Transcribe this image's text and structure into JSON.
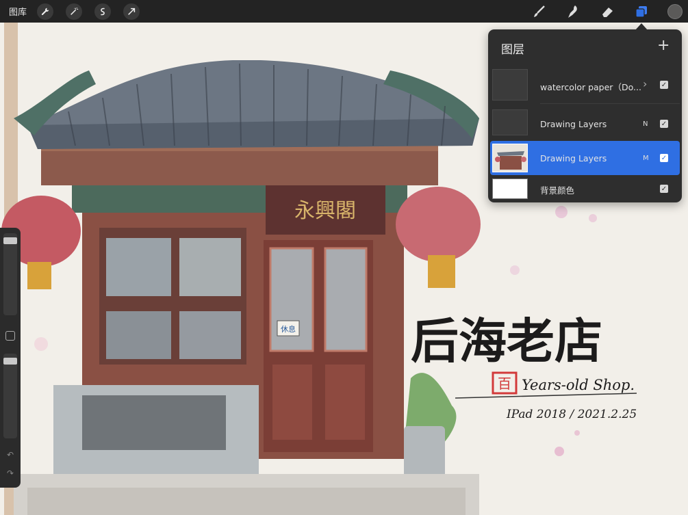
{
  "topbar": {
    "gallery_label": "图库",
    "left_tools": [
      "wrench-icon",
      "magic-wand-icon",
      "selection-icon",
      "transform-arrow-icon"
    ],
    "right_tools": [
      "brush-icon",
      "smudge-icon",
      "eraser-icon",
      "layers-icon"
    ],
    "active_color": "#5b5a59",
    "accent": "#2f6fe3"
  },
  "artwork": {
    "sign_text": "永興閣",
    "door_note": "休息",
    "title": "后海老店",
    "seal": "百",
    "subtitle": "Years-old Shop.",
    "signature": "IPad 2018 / 2021.2.25"
  },
  "layers_panel": {
    "title": "图层",
    "add_label": "+",
    "layers": [
      {
        "name": "watercolor paper（Do...",
        "blend": "",
        "visible": true,
        "selected": false,
        "has_chevron": true
      },
      {
        "name": "Drawing Layers",
        "blend": "N",
        "visible": true,
        "selected": false
      },
      {
        "name": "Drawing Layers",
        "blend": "M",
        "visible": true,
        "selected": true
      },
      {
        "name": "背景颜色",
        "blend": "",
        "visible": true,
        "selected": false
      }
    ]
  }
}
